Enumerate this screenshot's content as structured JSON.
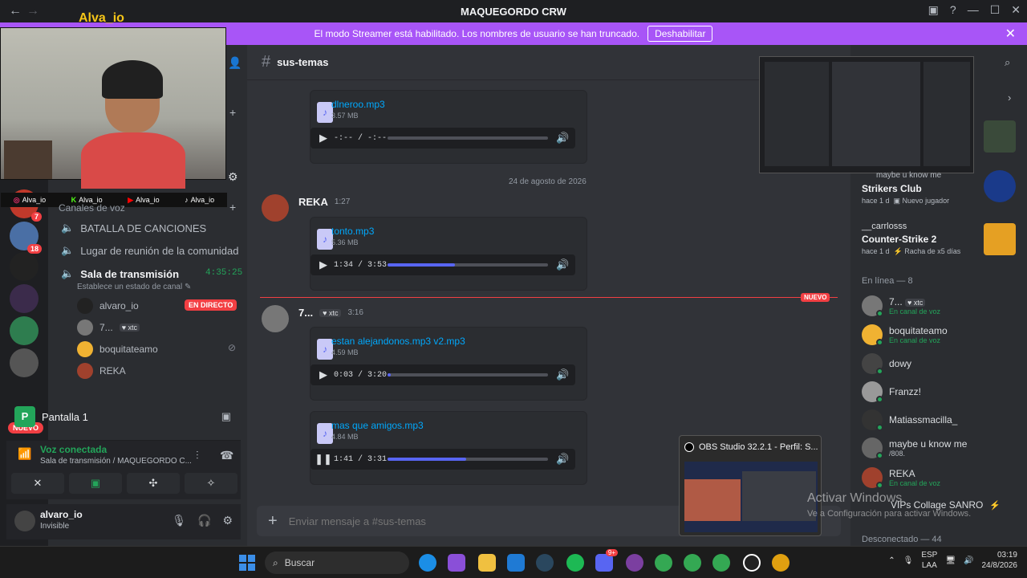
{
  "window": {
    "title": "MAQUEGORDO CRW"
  },
  "banner": {
    "text": "El modo Streamer está habilitado. Los nombres de usuario se han truncado.",
    "button": "Deshabilitar"
  },
  "overlay": {
    "streamer_name": "Alva_io",
    "socials": [
      {
        "icon": "instagram-icon",
        "name": "Alva_io"
      },
      {
        "icon": "kick-icon",
        "name": "Alva_io"
      },
      {
        "icon": "youtube-icon",
        "name": "Alva_io"
      },
      {
        "icon": "tiktok-icon",
        "name": "Alva_io"
      }
    ]
  },
  "servers": {
    "badges": [
      "7",
      "18"
    ],
    "new_pill": "NUEVO"
  },
  "sidebar": {
    "voice_header": "Canales de voz",
    "channels": [
      {
        "name": "BATALLA DE CANCIONES"
      },
      {
        "name": "Lugar de reunión de la comunidad"
      },
      {
        "name": "Sala de transmisión",
        "timer": "4:35:25",
        "status": "Establece un estado de canal"
      }
    ],
    "members": [
      {
        "name": "alvaro_io",
        "live": "EN DIRECTO"
      },
      {
        "name": "7...",
        "tag": "xtc"
      },
      {
        "name": "boquitateamo"
      },
      {
        "name": "REKA"
      }
    ],
    "screen_share": {
      "icon_letter": "P",
      "label": "Pantalla 1"
    },
    "voice": {
      "title": "Voz conectada",
      "subtitle": "Sala de transmisión / MAQUEGORDO C..."
    },
    "user": {
      "name": "alvaro_io",
      "status": "Invisible"
    }
  },
  "chat": {
    "channel": "sus-temas",
    "date_separator": "24 de agosto de 2026",
    "new_label": "NUEVO",
    "attachments": [
      {
        "file": "dlneroo.mp3",
        "size": "3.57 MB",
        "time": "-:-- / -:--",
        "progress": 0
      },
      {
        "file": "tonto.mp3",
        "size": "5.36 MB",
        "time": "1:34 / 3:53",
        "progress": 0.42
      },
      {
        "file": "estan alejandonos.mp3 v2.mp3",
        "size": "4.59 MB",
        "time": "0:03 / 3:20",
        "progress": 0.02
      },
      {
        "file": "mas que amigos.mp3",
        "size": "4.84 MB",
        "time": "1:41 / 3:31",
        "progress": 0.49
      }
    ],
    "messages": [
      {
        "author": "REKA",
        "timestamp": "1:27"
      },
      {
        "author": "7...",
        "tag": "xtc",
        "timestamp": "3:16"
      }
    ],
    "composer_placeholder": "Enviar mensaje a #sus-temas"
  },
  "members_panel": {
    "activities": [
      {
        "title": "Strikers Club",
        "meta1": "hace 1 d",
        "meta2": "Nuevo jugador",
        "above": "maybe u know me"
      },
      {
        "user": "__carrlosss",
        "title": "Counter-Strike 2",
        "meta1": "hace 1 d",
        "meta2": "Racha de x5 días"
      }
    ],
    "online_header": "En línea — 8",
    "online": [
      {
        "name": "7...",
        "tag": "xtc",
        "status": "En canal de voz"
      },
      {
        "name": "boquitateamo",
        "status": "En canal de voz"
      },
      {
        "name": "dowy",
        "status": ""
      },
      {
        "name": "Franzz!",
        "status": ""
      },
      {
        "name": "Matiassmacilla_",
        "status": ""
      },
      {
        "name": "maybe u know me",
        "status": "/808."
      },
      {
        "name": "REKA",
        "status": "En canal de voz"
      },
      {
        "name": "VIPs Collage SANRO",
        "status": ""
      }
    ],
    "offline_header": "Desconectado — 44"
  },
  "obs_preview": {
    "title": "OBS Studio 32.2.1 - Perfil: S..."
  },
  "watermark": {
    "line1": "Activar Windows",
    "line2": "Ve a Configuración para activar Windows."
  },
  "taskbar": {
    "search": "Buscar",
    "lang1": "ESP",
    "lang2": "LAA",
    "time": "03:19",
    "date": "24/8/2026",
    "discord_badge": "9+"
  }
}
